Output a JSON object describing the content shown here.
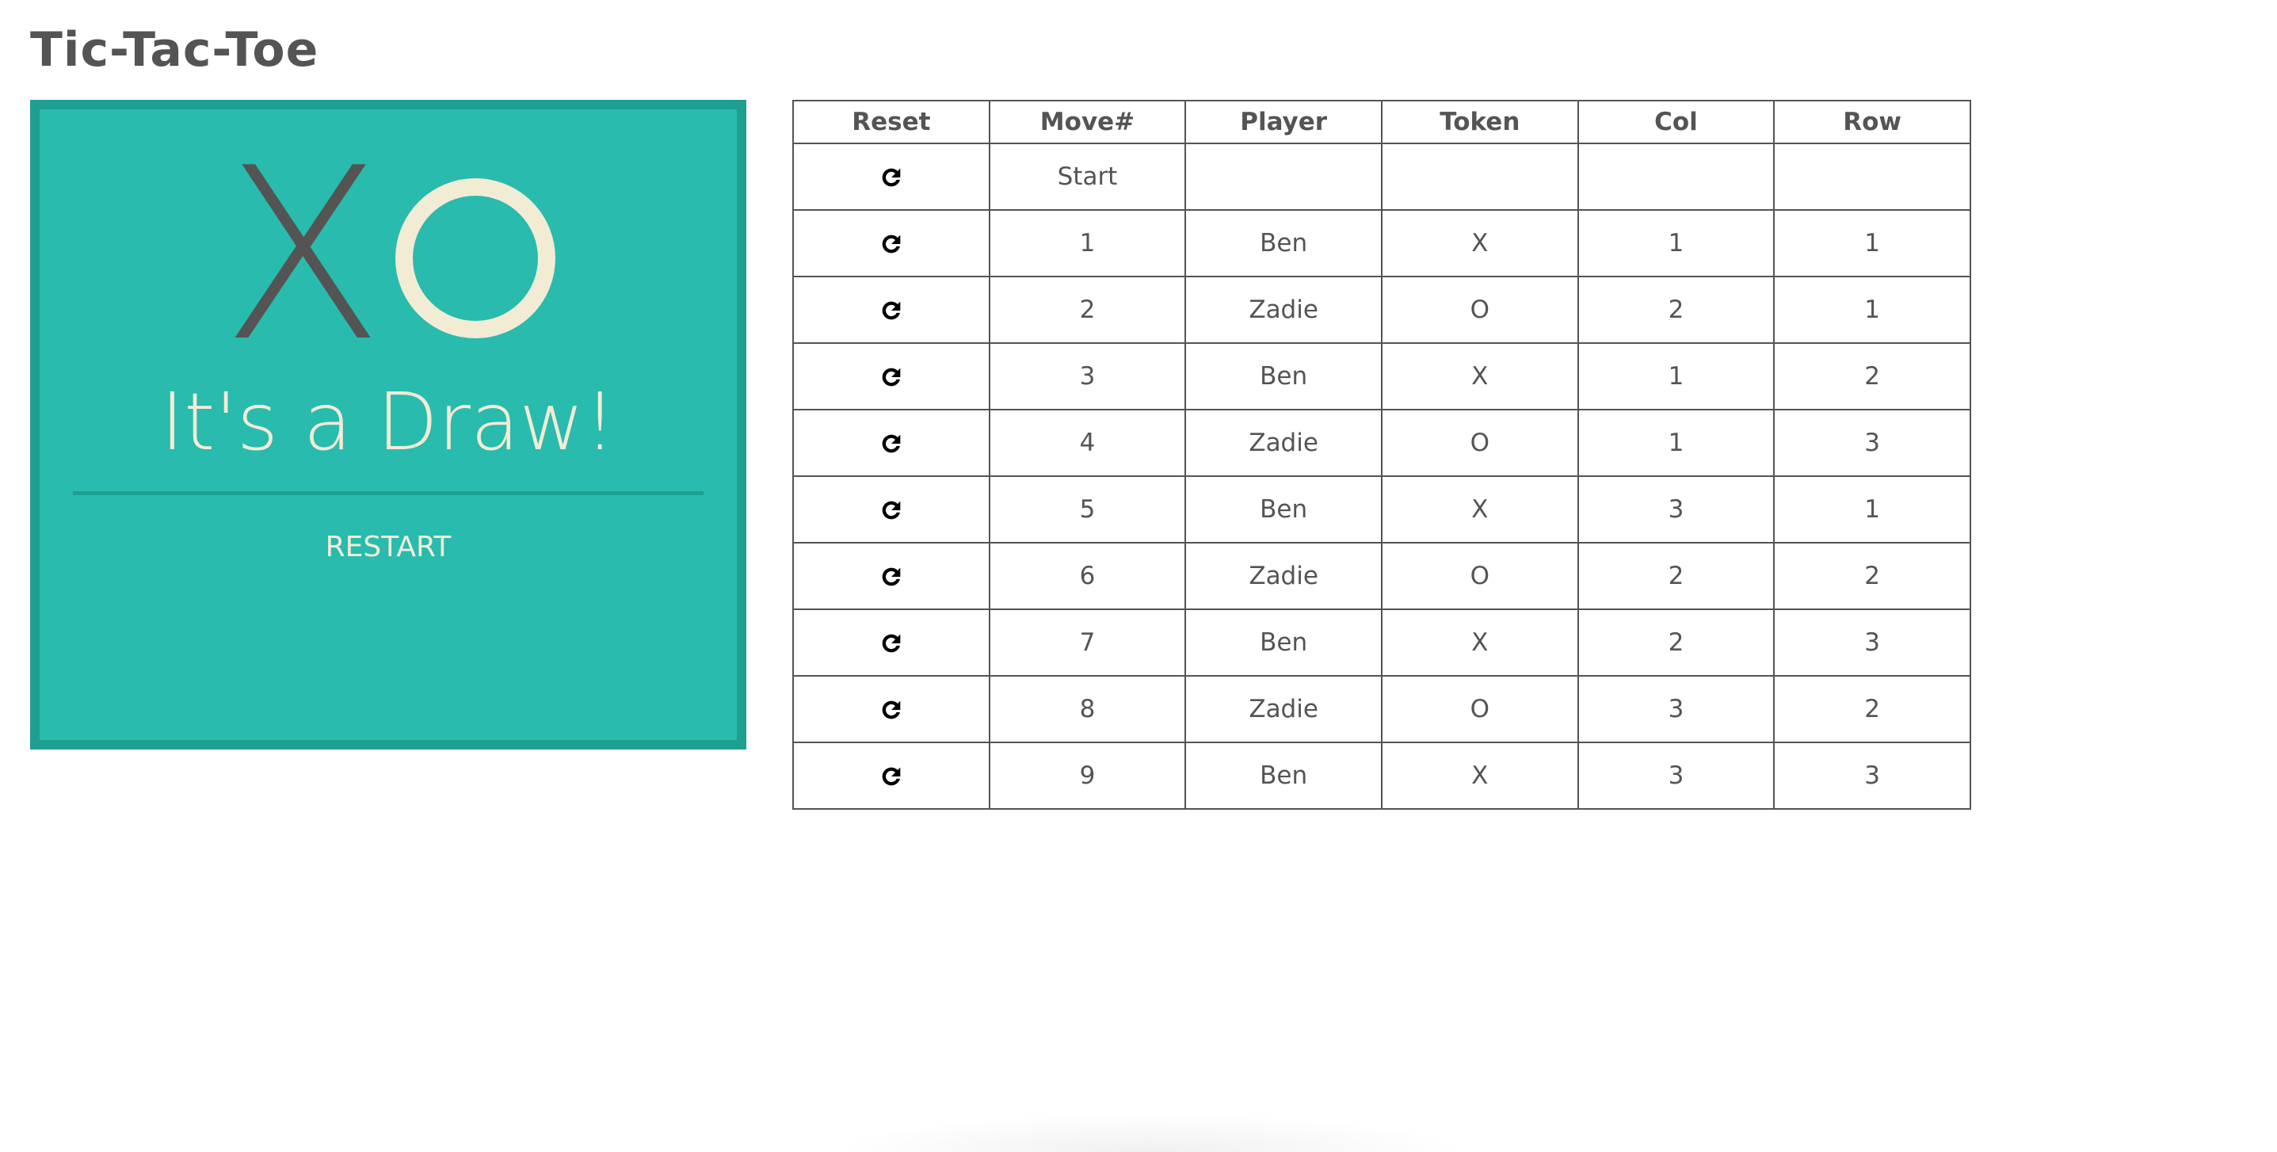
{
  "page": {
    "title": "Tic-Tac-Toe"
  },
  "board": {
    "token_x": "X",
    "token_o": "O",
    "result": "It's a Draw!",
    "restart_label": "RESTART",
    "colors": {
      "background": "#29bbad",
      "border": "#1f9e92",
      "x_token": "#545454",
      "o_token": "#f2ecd5",
      "text": "#f2ecd5"
    }
  },
  "history": {
    "headers": {
      "reset": "Reset",
      "move": "Move#",
      "player": "Player",
      "token": "Token",
      "col": "Col",
      "row": "Row"
    },
    "reset_icon": "redo-icon",
    "rows": [
      {
        "move": "Start",
        "player": "",
        "token": "",
        "col": "",
        "row": ""
      },
      {
        "move": "1",
        "player": "Ben",
        "token": "X",
        "col": "1",
        "row": "1"
      },
      {
        "move": "2",
        "player": "Zadie",
        "token": "O",
        "col": "2",
        "row": "1"
      },
      {
        "move": "3",
        "player": "Ben",
        "token": "X",
        "col": "1",
        "row": "2"
      },
      {
        "move": "4",
        "player": "Zadie",
        "token": "O",
        "col": "1",
        "row": "3"
      },
      {
        "move": "5",
        "player": "Ben",
        "token": "X",
        "col": "3",
        "row": "1"
      },
      {
        "move": "6",
        "player": "Zadie",
        "token": "O",
        "col": "2",
        "row": "2"
      },
      {
        "move": "7",
        "player": "Ben",
        "token": "X",
        "col": "2",
        "row": "3"
      },
      {
        "move": "8",
        "player": "Zadie",
        "token": "O",
        "col": "3",
        "row": "2"
      },
      {
        "move": "9",
        "player": "Ben",
        "token": "X",
        "col": "3",
        "row": "3"
      }
    ]
  }
}
